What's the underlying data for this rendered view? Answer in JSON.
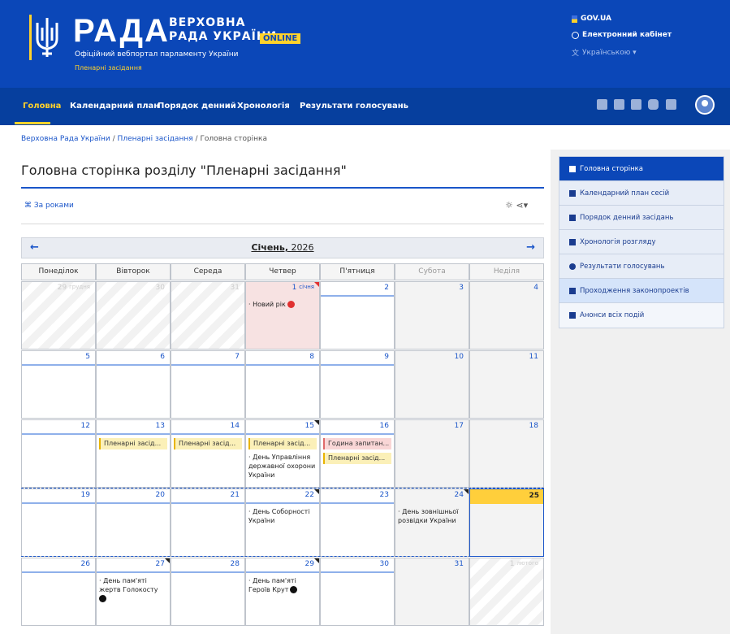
{
  "header": {
    "brand": "РАДА",
    "brand_line1": "ВЕРХОВНА",
    "brand_line2": "РАДА УКРАЇНИ",
    "online_badge": "ONLINE",
    "subtitle": "Офіційний вебпортал парламенту України",
    "section": "Пленарні засідання",
    "gov": "GOV.UA",
    "cabinet": "Електронний кабінет",
    "language": "Українською ▾"
  },
  "nav": {
    "items": [
      "Головна",
      "Календарний план",
      "Порядок денний",
      "Хронологія",
      "Результати голосувань"
    ]
  },
  "breadcrumb": {
    "home": "Верховна Рада України",
    "section": "Пленарні засідання",
    "current": "Головна сторінка",
    "sep": "/"
  },
  "page": {
    "title": "Головна сторінка розділу \"Пленарні засідання\"",
    "by_years": "За роками",
    "tools": "☼  ⋖▾"
  },
  "calendar": {
    "month": "Січень,",
    "year": "2026",
    "prev": "←",
    "next": "→",
    "weekdays": [
      "Понеділок",
      "Вівторок",
      "Середа",
      "Четвер",
      "П'ятниця",
      "Субота",
      "Неділя"
    ],
    "prev_month_label": "грудня",
    "jan1_label": "січня",
    "next_month_label": "лютого",
    "days": [
      "29",
      "30",
      "31",
      "1",
      "2",
      "3",
      "4",
      "5",
      "6",
      "7",
      "8",
      "9",
      "10",
      "11",
      "12",
      "13",
      "14",
      "15",
      "16",
      "17",
      "18",
      "19",
      "20",
      "21",
      "22",
      "23",
      "24",
      "25",
      "26",
      "27",
      "28",
      "29",
      "30",
      "31",
      "1"
    ],
    "events": {
      "new_year": "· Новий рік",
      "plenary": "Пленарні засід...",
      "question_hour": "Година запитан...",
      "guard_day": "· День Управління державної охорони України",
      "unity_day": "· День Соборності України",
      "intel_day": "· День зовнішньої розвідки України",
      "holocaust_day": "· День пам'яті жертв Голокосту",
      "kruty_day": "· День пам'яті Героїв Крут"
    }
  },
  "sidebar": {
    "items": [
      "Головна сторінка",
      "Календарний план сесій",
      "Порядок денний засідань",
      "Хронологія розгляду",
      "Результати голосувань",
      "Проходження законопроектів",
      "Анонси всіх подій"
    ]
  }
}
